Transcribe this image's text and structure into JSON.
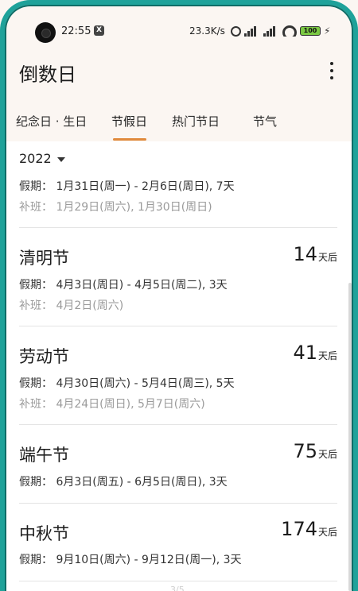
{
  "status_bar": {
    "time": "22:55",
    "notif_badge": "X",
    "net_speed": "23.3K/s",
    "battery": "100"
  },
  "header": {
    "title": "倒数日"
  },
  "tabs": [
    {
      "label": "纪念日 · 生日",
      "active": false
    },
    {
      "label": "节假日",
      "active": true
    },
    {
      "label": "热门节日",
      "active": false
    },
    {
      "label": "节气",
      "active": false
    }
  ],
  "year_selector": "2022",
  "spring_festival": {
    "holiday": "假期：  1月31日(周一) - 2月6日(周日), 7天",
    "workday": "补班：  1月29日(周六), 1月30日(周日)"
  },
  "holidays": [
    {
      "name": "清明节",
      "days": "14",
      "unit": "天后",
      "holiday": "假期：  4月3日(周日) - 4月5日(周二), 3天",
      "workday": "补班：  4月2日(周六)"
    },
    {
      "name": "劳动节",
      "days": "41",
      "unit": "天后",
      "holiday": "假期：  4月30日(周六) - 5月4日(周三), 5天",
      "workday": "补班：  4月24日(周日), 5月7日(周六)"
    },
    {
      "name": "端午节",
      "days": "75",
      "unit": "天后",
      "holiday": "假期：  6月3日(周五) - 6月5日(周日), 3天",
      "workday": ""
    },
    {
      "name": "中秋节",
      "days": "174",
      "unit": "天后",
      "holiday": "假期：  9月10日(周六) - 9月12日(周一), 3天",
      "workday": ""
    }
  ],
  "pager": "3/5",
  "colors": {
    "accent": "#e08a3c",
    "frame": "#1fa29a",
    "header_bg": "#fbf6f2"
  }
}
